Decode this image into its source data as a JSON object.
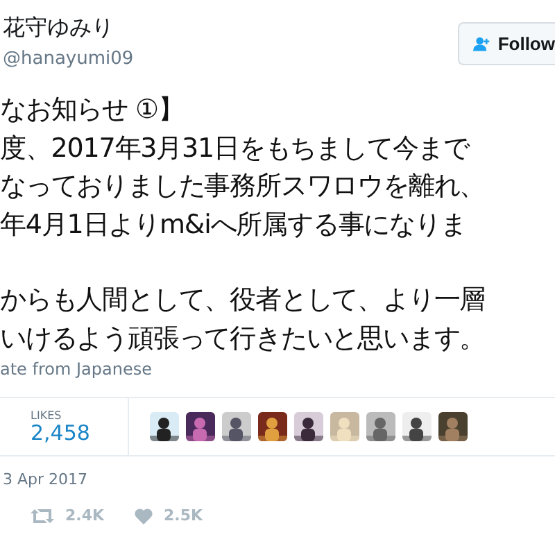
{
  "author": {
    "name": "花守ゆみり",
    "handle": "@hanayumi09"
  },
  "follow_button": {
    "label": "Follow"
  },
  "tweet_paragraphs": [
    [
      "なお知らせ ①】",
      "度、2017年3月31日をもちまして今まで",
      "なっておりました事務所スワロウを離れ、",
      "年4月1日よりm&iへ所属する事になりま"
    ],
    [
      "からも人間として、役者として、より一層",
      "いけるよう頑張って行きたいと思います。"
    ]
  ],
  "translate_link": "ate from Japanese",
  "stats": {
    "label": "LIKES",
    "value": "2,458"
  },
  "date": "3 Apr 2017",
  "actions": [
    {
      "kind": "retweet",
      "count": "2.4K"
    },
    {
      "kind": "like",
      "count": "2.5K"
    }
  ]
}
